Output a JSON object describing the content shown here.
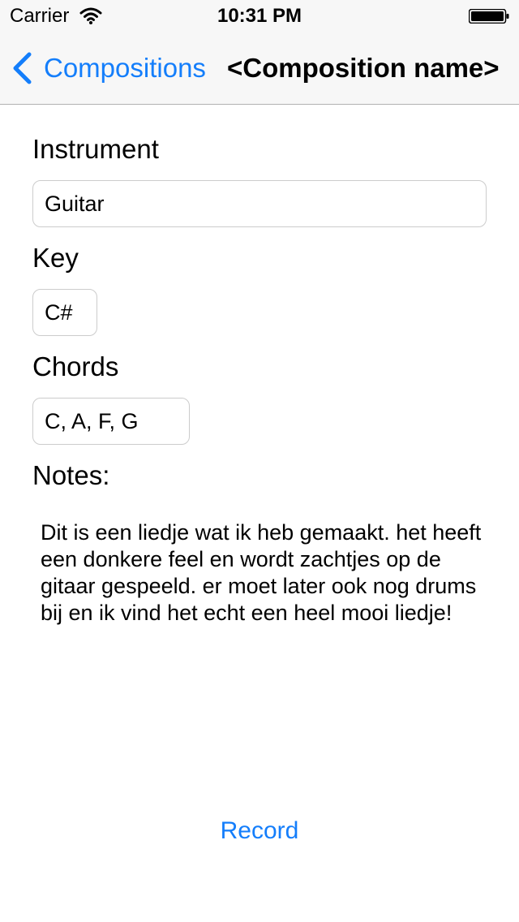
{
  "status_bar": {
    "carrier": "Carrier",
    "time": "10:31 PM"
  },
  "nav": {
    "back_label": "Compositions",
    "title": "<Composition name>",
    "accent_color": "#147efb"
  },
  "form": {
    "instrument": {
      "label": "Instrument",
      "value": "Guitar"
    },
    "key": {
      "label": "Key",
      "value": "C#"
    },
    "chords": {
      "label": "Chords",
      "value": "C, A, F, G"
    },
    "notes": {
      "label": "Notes:",
      "text": "Dit is een liedje wat ik heb gemaakt. het heeft een donkere feel en wordt zachtjes op de gitaar gespeeld. er moet later ook nog drums bij en ik vind het echt een heel mooi liedje!"
    }
  },
  "actions": {
    "record_label": "Record"
  }
}
